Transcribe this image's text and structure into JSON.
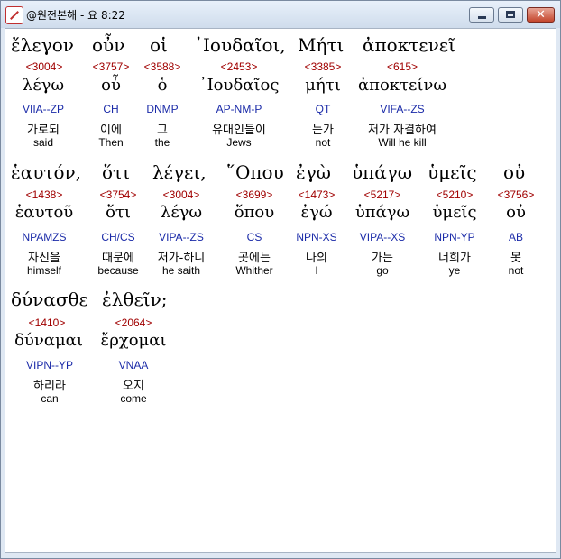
{
  "window": {
    "title": "@원전본해 - 요 8:22",
    "minimize": "minimize",
    "maximize": "maximize",
    "close": "✕"
  },
  "words": [
    {
      "greek": "ἔλεγον",
      "strong": "<3004>",
      "lemma": "λέγω",
      "parse": "VIIA--ZP",
      "korean": "가로되",
      "english": "said"
    },
    {
      "greek": "οὖν",
      "strong": "<3757>",
      "lemma": "οὗ",
      "parse": "CH",
      "korean": "이에",
      "english": "Then"
    },
    {
      "greek": "οἱ",
      "strong": "<3588>",
      "lemma": "ὁ",
      "parse": "DNMP",
      "korean": "그",
      "english": "the"
    },
    {
      "greek": "᾿Ιουδαῖοι,",
      "strong": "<2453>",
      "lemma": "᾿Ιουδαῖος",
      "parse": "AP-NM-P",
      "korean": "유대인들이",
      "english": "Jews"
    },
    {
      "greek": "Μήτι",
      "strong": "<3385>",
      "lemma": "μήτι",
      "parse": "QT",
      "korean": "는가",
      "english": "not"
    },
    {
      "greek": "ἀποκτενεῖ",
      "strong": "<615>",
      "lemma": "ἀποκτείνω",
      "parse": "VIFA--ZS",
      "korean": "저가 자결하여",
      "english": "Will he kill"
    },
    {
      "greek": "ἑαυτόν,",
      "strong": "<1438>",
      "lemma": "ἑαυτοῦ",
      "parse": "NPAMZS",
      "korean": "자신을",
      "english": "himself"
    },
    {
      "greek": "ὅτι",
      "strong": "<3754>",
      "lemma": "ὅτι",
      "parse": "CH/CS",
      "korean": "때문에",
      "english": "because"
    },
    {
      "greek": "λέγει,",
      "strong": "<3004>",
      "lemma": "λέγω",
      "parse": "VIPA--ZS",
      "korean": "저가-하니",
      "english": "he saith"
    },
    {
      "greek": "῞Οπου",
      "strong": "<3699>",
      "lemma": "ὅπου",
      "parse": "CS",
      "korean": "곳에는",
      "english": "Whither"
    },
    {
      "greek": "ἐγὼ",
      "strong": "<1473>",
      "lemma": "ἐγώ",
      "parse": "NPN-XS",
      "korean": "나의",
      "english": "I"
    },
    {
      "greek": "ὑπάγω",
      "strong": "<5217>",
      "lemma": "ὑπάγω",
      "parse": "VIPA--XS",
      "korean": "가는",
      "english": "go"
    },
    {
      "greek": "ὑμεῖς",
      "strong": "<5210>",
      "lemma": "ὑμεῖς",
      "parse": "NPN-YP",
      "korean": "너희가",
      "english": "ye"
    },
    {
      "greek": "οὐ",
      "strong": "<3756>",
      "lemma": "οὐ",
      "parse": "AB",
      "korean": "못",
      "english": "not"
    },
    {
      "greek": "δύνασθε",
      "strong": "<1410>",
      "lemma": "δύναμαι",
      "parse": "VIPN--YP",
      "korean": "하리라",
      "english": "can"
    },
    {
      "greek": "ἐλθεῖν;",
      "strong": "<2064>",
      "lemma": "ἔρχομαι",
      "parse": "VNAA",
      "korean": "오지",
      "english": "come"
    }
  ]
}
